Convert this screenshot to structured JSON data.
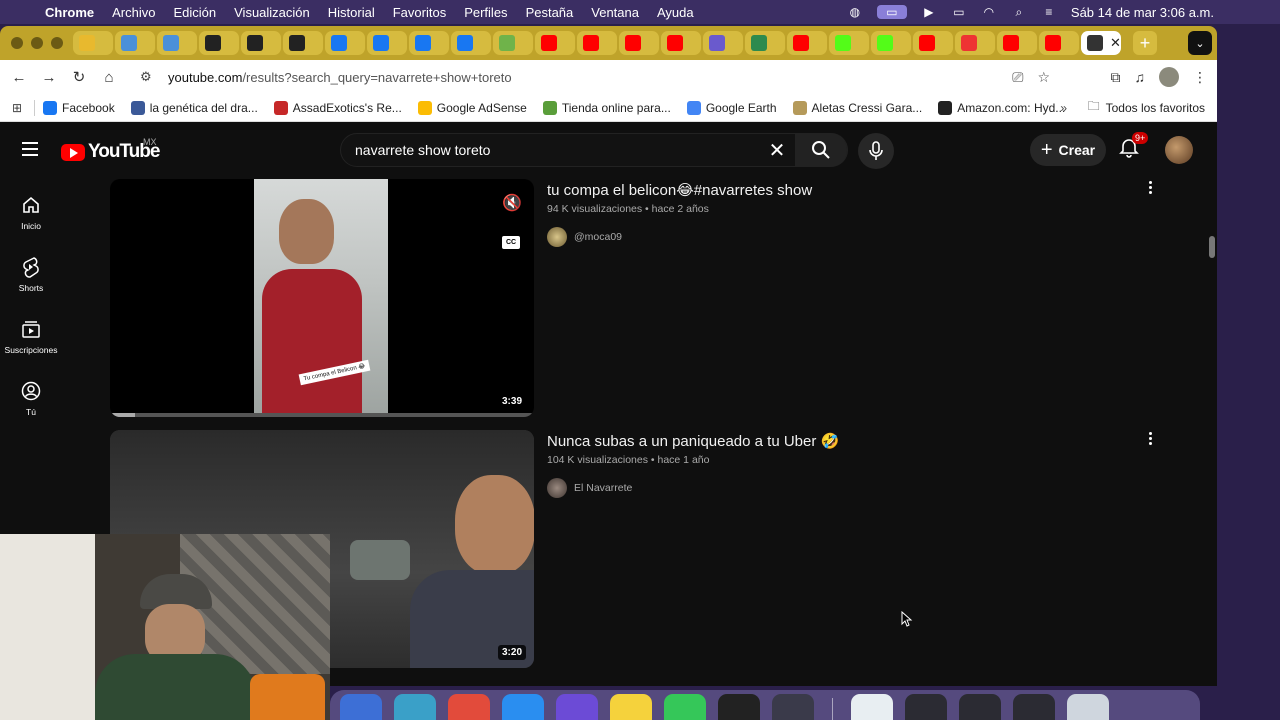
{
  "menubar": {
    "app": "Chrome",
    "items": [
      "Archivo",
      "Edición",
      "Visualización",
      "Historial",
      "Favoritos",
      "Perfiles",
      "Pestaña",
      "Ventana",
      "Ayuda"
    ],
    "datetime": "Sáb 14 de mar  3:06 a.m."
  },
  "tabs": {
    "favicons": [
      {
        "icon": "chrome-icon",
        "color": "#e8b92e"
      },
      {
        "icon": "cloud-icon",
        "color": "#4a90d9"
      },
      {
        "icon": "cloud-icon",
        "color": "#4a90d9"
      },
      {
        "icon": "doc-icon",
        "color": "#222222"
      },
      {
        "icon": "doc-icon",
        "color": "#222222"
      },
      {
        "icon": "doc-icon",
        "color": "#222222"
      },
      {
        "icon": "meta-icon",
        "color": "#1877f2"
      },
      {
        "icon": "facebook-icon",
        "color": "#1877f2"
      },
      {
        "icon": "facebook-icon",
        "color": "#1877f2"
      },
      {
        "icon": "facebook-icon",
        "color": "#1877f2"
      },
      {
        "icon": "green-icon",
        "color": "#6fb34a"
      },
      {
        "icon": "youtube-icon",
        "color": "#ff0000"
      },
      {
        "icon": "youtube-icon",
        "color": "#ff0000"
      },
      {
        "icon": "youtube-icon",
        "color": "#ff0000"
      },
      {
        "icon": "youtube-icon",
        "color": "#ff0000"
      },
      {
        "icon": "app-icon",
        "color": "#6a5acd"
      },
      {
        "icon": "ai-icon",
        "color": "#2d8a4e"
      },
      {
        "icon": "youtube-icon",
        "color": "#ff0000"
      },
      {
        "icon": "kick-icon",
        "color": "#53fc18"
      },
      {
        "icon": "kick-icon",
        "color": "#53fc18"
      },
      {
        "icon": "youtube-icon",
        "color": "#ff0000"
      },
      {
        "icon": "pokeball-icon",
        "color": "#e33"
      },
      {
        "icon": "youtube-icon",
        "color": "#ff0000"
      },
      {
        "icon": "youtube-icon",
        "color": "#ff0000"
      }
    ],
    "new_tab": "+"
  },
  "toolbar": {
    "url_host": "youtube.com",
    "url_path": "/results?search_query=navarrete+show+toreto"
  },
  "bookmarks": [
    {
      "label": "Facebook",
      "color": "#1877f2"
    },
    {
      "label": "la genética del dra...",
      "color": "#3b5998"
    },
    {
      "label": "AssadExotics's Re...",
      "color": "#c62828"
    },
    {
      "label": "Google AdSense",
      "color": "#fbbc04"
    },
    {
      "label": "Tienda online para...",
      "color": "#5a9e3a"
    },
    {
      "label": "Google Earth",
      "color": "#4285f4"
    },
    {
      "label": "Aletas Cressi Gara...",
      "color": "#b59a5a"
    },
    {
      "label": "Amazon.com: Hyd...",
      "color": "#222222"
    }
  ],
  "bookmarks_more": "»",
  "all_favorites": "Todos los favoritos",
  "youtube": {
    "logo": "YouTube",
    "country": "MX",
    "search_query": "navarrete show toreto",
    "create_label": "Crear",
    "notifications": "9+",
    "guide": [
      {
        "label": "Inicio",
        "icon": "home-icon"
      },
      {
        "label": "Shorts",
        "icon": "shorts-icon"
      },
      {
        "label": "Suscripciones",
        "icon": "subscriptions-icon"
      },
      {
        "label": "Tú",
        "icon": "you-icon"
      }
    ],
    "results": [
      {
        "title": "tu compa el belicon😂#navarretes show",
        "views": "94 K visualizaciones",
        "age": "hace 2 años",
        "channel": "@moca09",
        "duration": "3:39",
        "caption": "Tu compa el Belicon 😂"
      },
      {
        "title": "Nunca subas a un paniqueado a tu Uber 🤣",
        "views": "104 K visualizaciones",
        "age": "hace 1 año",
        "channel": "El Navarrete",
        "duration": "3:20"
      }
    ]
  }
}
